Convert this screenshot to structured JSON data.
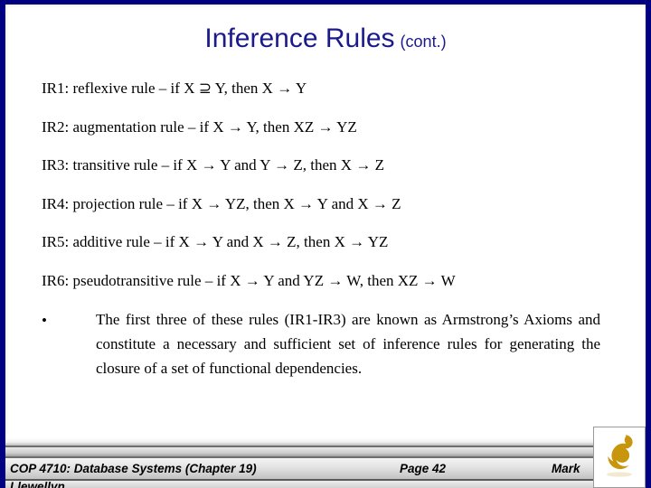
{
  "slide": {
    "title_main": "Inference Rules",
    "title_suffix": "(cont.)",
    "title_color": "#1a1a8c",
    "frame_color": "#000080"
  },
  "rules": [
    {
      "id": "ir1",
      "text": "IR1:  reflexive rule – if X ⊇ Y, then X → Y"
    },
    {
      "id": "ir2",
      "text": "IR2: augmentation rule – if X → Y, then XZ → YZ"
    },
    {
      "id": "ir3",
      "text": "IR3: transitive rule – if X → Y and Y → Z, then X → Z"
    },
    {
      "id": "ir4",
      "text": "IR4: projection rule – if X → YZ, then X → Y and X → Z"
    },
    {
      "id": "ir5",
      "text": "IR5: additive rule – if X → Y and X → Z, then X → YZ"
    },
    {
      "id": "ir6",
      "text": "IR6: pseudotransitive rule – if X → Y and YZ → W, then XZ → W"
    }
  ],
  "bullet": {
    "marker": "•",
    "text": "The first three of these rules (IR1-IR3) are known as Armstrong’s Axioms and constitute a necessary and sufficient set of inference rules for generating the closure of a set of functional dependencies."
  },
  "footer": {
    "course": "COP 4710: Database Systems  (Chapter 19)",
    "page": "Page 42",
    "author_first_line": "Mark",
    "author_second_line": "Llewellyn",
    "logo_name": "ucf-pegasus-logo",
    "logo_color": "#c8960c"
  }
}
